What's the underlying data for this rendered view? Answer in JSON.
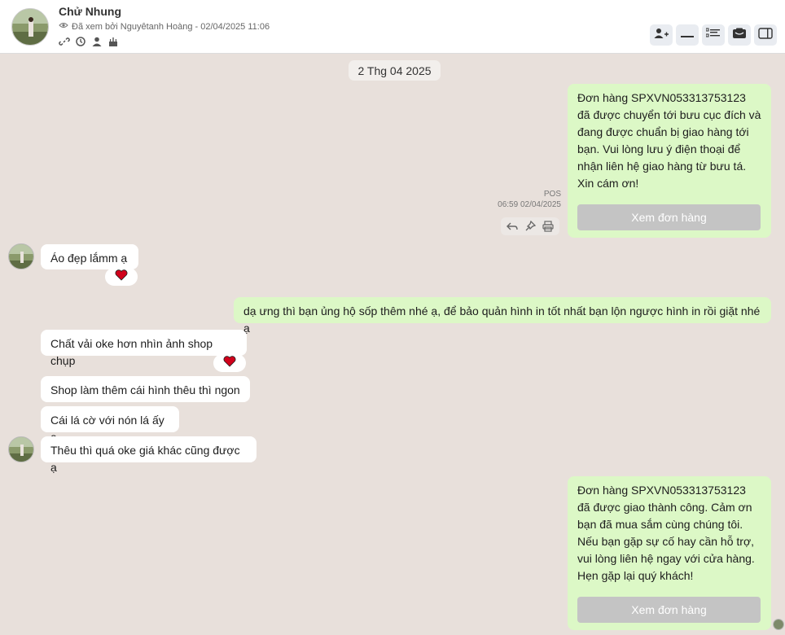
{
  "header": {
    "contact_name": "Chử Nhung",
    "seen_text": "Đã xem bởi Nguyêtanh Hoàng - 02/04/2025 11:06"
  },
  "date_separator": "2 Thg 04 2025",
  "messages": {
    "m1_text": "Đơn hàng SPXVN053313753123 đã được chuyển tới bưu cục đích và đang được chuẩn bị giao hàng tới bạn. Vui lòng lưu ý điện thoại để nhận liên hệ giao hàng từ bưu tá. Xin cám ơn!",
    "m1_button": "Xem đơn hàng",
    "m1_sender": "POS",
    "m1_time": "06:59 02/04/2025",
    "m2_text": "Áo đẹp lắmm ạ",
    "m3_text": "dạ ưng thì bạn ủng hộ sốp thêm nhé ạ, để bảo quản hình in tốt nhất bạn lộn ngược hình in rồi giặt nhé ạ",
    "m4_text": "Chất vải oke hơn nhìn ảnh shop chụp",
    "m5_text": "Shop làm thêm cái hình thêu thì ngon",
    "m6_text": "Cái lá cờ với nón lá ấy ạ",
    "m7_text": "Thêu thì quá oke giá khác cũng được ạ",
    "m8_text": "Đơn hàng SPXVN053313753123 đã được giao thành công. Cảm ơn bạn đã mua sắm cùng chúng tôi. Nếu bạn gặp sự cố hay cần hỗ trợ, vui lòng liên hệ ngay với cửa hàng. Hẹn gặp lại quý khách!",
    "m8_button": "Xem đơn hàng"
  },
  "colors": {
    "chat_background": "#e8e0db",
    "outgoing_bubble": "#dcf8c6",
    "incoming_bubble": "#ffffff",
    "reaction_heart": "#d0021b"
  },
  "icons": [
    "eye-icon",
    "link-icon",
    "history-icon",
    "user-icon",
    "cake-icon",
    "add-user-icon",
    "minus-icon",
    "list-icon",
    "folder-icon",
    "sidebar-icon",
    "reply-icon",
    "pin-icon",
    "print-icon",
    "heart-icon"
  ]
}
